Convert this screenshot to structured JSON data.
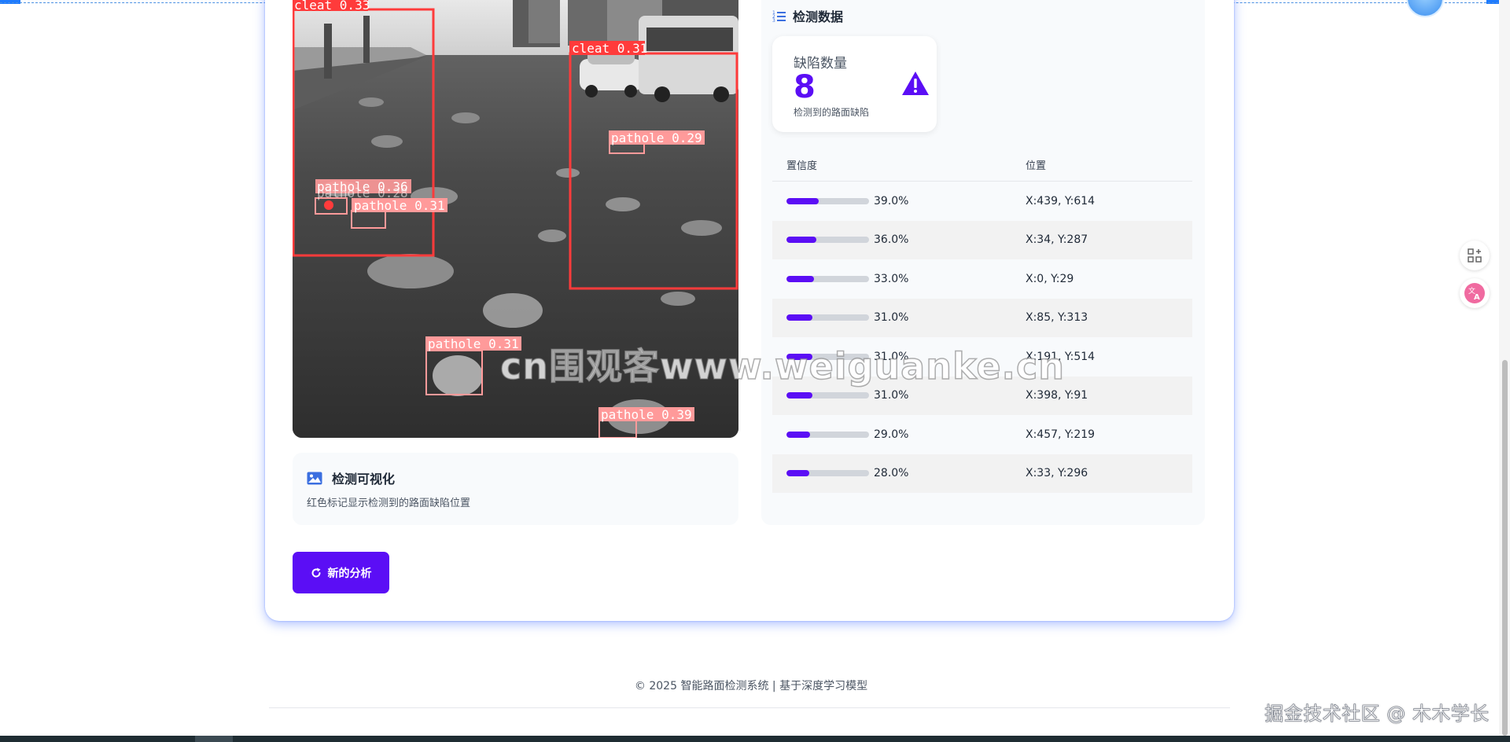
{
  "detections_overlay": [
    {
      "label": "cleat 0.33"
    },
    {
      "label": "cleat 0.31"
    },
    {
      "label": "pathole 0.29"
    },
    {
      "label": "pathole 0.36"
    },
    {
      "label": "pathole 0.28"
    },
    {
      "label": "pathole 0.31"
    },
    {
      "label": "pathole 0.31"
    },
    {
      "label": "pathole 0.39"
    }
  ],
  "watermark": "cn围观客www.weiguanke.cn",
  "visualization": {
    "title": "检测可视化",
    "description": "红色标记显示检测到的路面缺陷位置",
    "icon": "image-icon"
  },
  "new_button": {
    "label": "新的分析",
    "icon": "refresh-icon"
  },
  "data_section": {
    "title": "检测数据",
    "icon": "list-ordered-icon",
    "count_label": "缺陷数量",
    "count_value": "8",
    "count_sub": "检测到的路面缺陷",
    "count_icon": "warning-triangle-icon"
  },
  "table": {
    "headers": [
      "置信度",
      "位置"
    ],
    "rows": [
      {
        "confidence": 39.0,
        "confidence_text": "39.0%",
        "position": "X:439, Y:614"
      },
      {
        "confidence": 36.0,
        "confidence_text": "36.0%",
        "position": "X:34, Y:287"
      },
      {
        "confidence": 33.0,
        "confidence_text": "33.0%",
        "position": "X:0, Y:29"
      },
      {
        "confidence": 31.0,
        "confidence_text": "31.0%",
        "position": "X:85, Y:313"
      },
      {
        "confidence": 31.0,
        "confidence_text": "31.0%",
        "position": "X:191, Y:514"
      },
      {
        "confidence": 31.0,
        "confidence_text": "31.0%",
        "position": "X:398, Y:91"
      },
      {
        "confidence": 29.0,
        "confidence_text": "29.0%",
        "position": "X:457, Y:219"
      },
      {
        "confidence": 28.0,
        "confidence_text": "28.0%",
        "position": "X:33, Y:296"
      }
    ]
  },
  "footer": "© 2025 智能路面检测系统 | 基于深度学习模型",
  "juejin_watermark": "掘金技术社区 @ 木木学长",
  "colors": {
    "accent": "#5b0ef5",
    "box": "#ff3b3b",
    "box_light": "#ff9a9a"
  }
}
